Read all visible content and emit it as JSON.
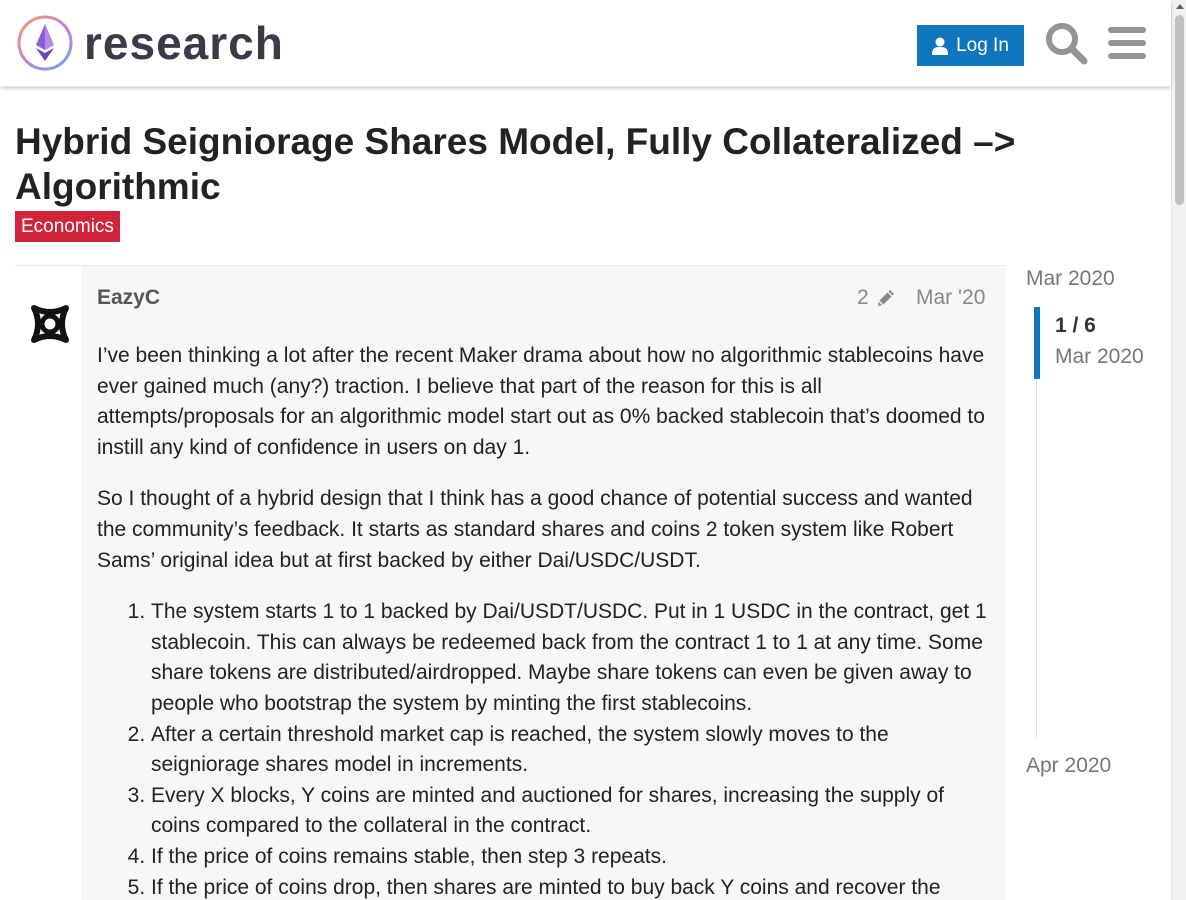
{
  "header": {
    "site_name": "research",
    "login_label": "Log In"
  },
  "topic": {
    "title": "Hybrid Seigniorage Shares Model, Fully Collateralized –> Algorithmic",
    "category": "Economics",
    "category_color": "#d0243b"
  },
  "post": {
    "username": "EazyC",
    "edit_count": "2",
    "date": "Mar '20",
    "paragraphs": [
      "I’ve been thinking a lot after the recent Maker drama about how no algorithmic stablecoins have ever gained much (any?) traction. I believe that part of the reason for this is all attempts/proposals for an algorithmic model start out as 0% backed stablecoin that’s doomed to instill any kind of confidence in users on day 1.",
      "So I thought of a hybrid design that I think has a good chance of potential success and wanted the community’s feedback. It starts as standard shares and coins 2 token system like Robert Sams’ original idea but at first backed by either Dai/USDC/USDT."
    ],
    "list_items": [
      "The system starts 1 to 1 backed by Dai/USDT/USDC. Put in 1 USDC in the contract, get 1 stablecoin. This can always be redeemed back from the contract 1 to 1 at any time. Some share tokens are distributed/airdropped. Maybe share tokens can even be given away to people who bootstrap the system by minting the first stablecoins.",
      "After a certain threshold market cap is reached, the system slowly moves to the seigniorage shares model in increments.",
      "Every X blocks, Y coins are minted and auctioned for shares, increasing the supply of coins compared to the collateral in the contract.",
      "If the price of coins remains stable, then step 3 repeats.",
      "If the price of coins drop, then shares are minted to buy back Y coins and recover the"
    ]
  },
  "timeline": {
    "start_date": "Mar 2020",
    "position": "1 / 6",
    "position_date": "Mar 2020",
    "end_date": "Apr 2020"
  },
  "colors": {
    "accent": "#0e76bd",
    "post_bg": "#f7f7f7"
  }
}
